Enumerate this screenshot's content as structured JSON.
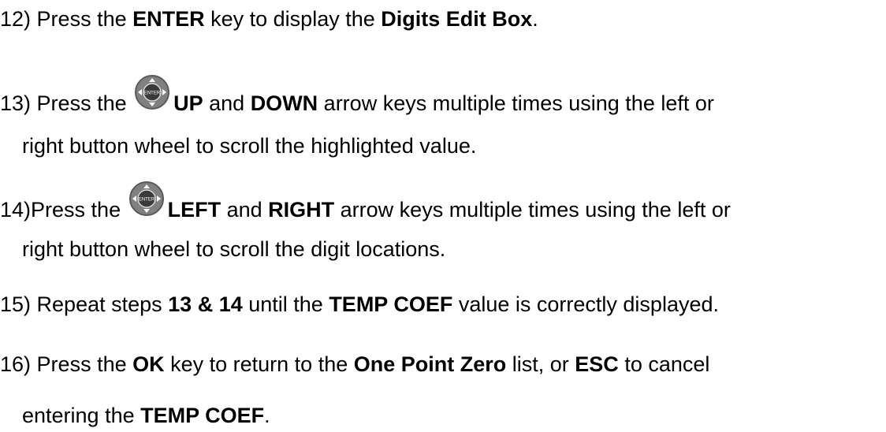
{
  "steps": [
    {
      "number": "12)",
      "parts": [
        "Press the ",
        "ENTER",
        " key to display the ",
        "Digits Edit Box",
        "."
      ]
    },
    {
      "number": "13)",
      "parts": [
        "Press the ",
        "UP",
        " and ",
        "DOWN",
        " arrow keys multiple times using the left or"
      ],
      "cont": "right button wheel to scroll the highlighted value."
    },
    {
      "number": "14)",
      "parts": [
        "Press the ",
        "LEFT",
        " and ",
        "RIGHT",
        " arrow keys multiple times using the left or"
      ],
      "cont": "right button wheel to scroll the digit locations."
    },
    {
      "number": "15)",
      "parts": [
        "Repeat steps ",
        "13 & 14",
        " until the ",
        "TEMP COEF",
        " value is correctly displayed."
      ]
    },
    {
      "number": "16)",
      "parts": [
        "Press the ",
        "OK",
        " key to return to the ",
        "One Point Zero",
        " list, or ",
        "ESC",
        " to cancel"
      ],
      "cont_parts": [
        "entering the ",
        "TEMP COEF",
        "."
      ]
    }
  ],
  "icons": {
    "dpad": "enter-dpad-icon",
    "dpad_center_label": "ENTER"
  },
  "colors": {
    "icon_body": "#808080",
    "icon_rim": "#5a5a5a",
    "icon_center": "#3a3a3a",
    "text": "#000000"
  }
}
